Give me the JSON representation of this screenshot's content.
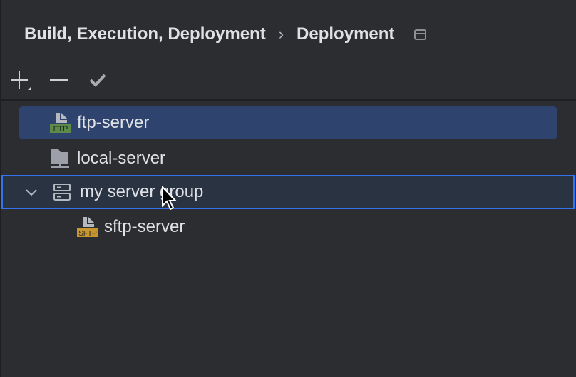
{
  "header": {
    "breadcrumb_parent": "Build, Execution, Deployment",
    "separator": "›",
    "title": "Deployment"
  },
  "toolbar": {
    "add": "add-icon",
    "remove": "remove-icon",
    "apply": "check-icon"
  },
  "tree": [
    {
      "label": "ftp-server",
      "icon": "ftp-icon",
      "badge": "FTP",
      "selected": true
    },
    {
      "label": "local-server",
      "icon": "local-server-icon"
    },
    {
      "label": "my server group",
      "icon": "server-group-icon",
      "expanded": true,
      "focused": true
    },
    {
      "label": "sftp-server",
      "icon": "sftp-icon",
      "badge": "SFTP"
    }
  ],
  "colors": {
    "selection": "#2e436e",
    "focus": "#3574f0",
    "ftp_badge": "#5c8a48",
    "sftp_badge": "#c9952f"
  }
}
